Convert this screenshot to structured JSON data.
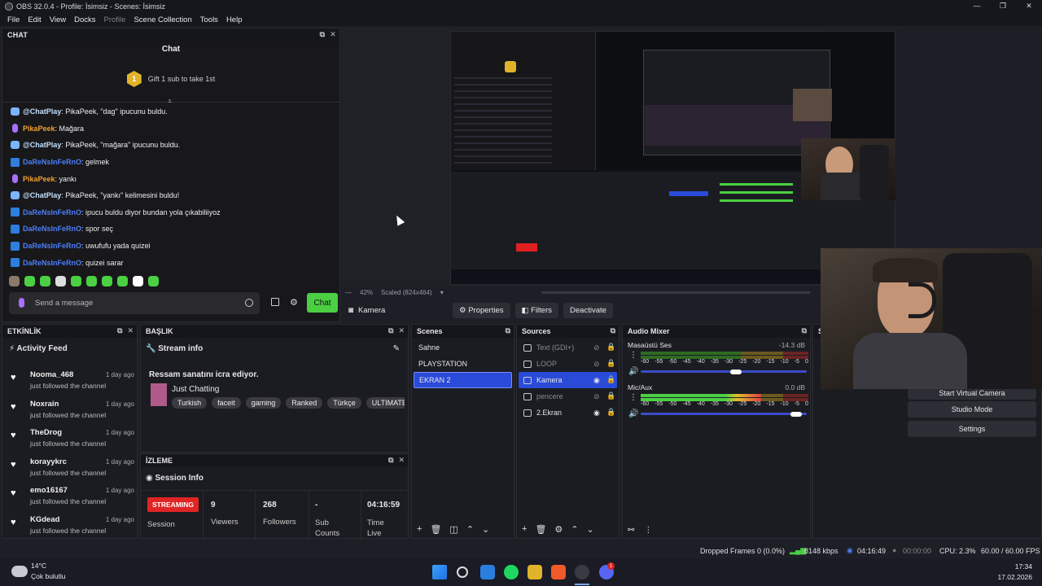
{
  "window": {
    "title": "OBS 32.0.4 - Profile: İsimsiz - Scenes: İsimsiz"
  },
  "menu": [
    "File",
    "Edit",
    "View",
    "Docks",
    "Profile",
    "Scene Collection",
    "Tools",
    "Help"
  ],
  "chat": {
    "dock_title": "CHAT",
    "header": "Chat",
    "gift_badge": "1",
    "gift_text": "Gift 1 sub to take 1st",
    "messages": [
      {
        "icon": "bot",
        "name": "@ChatPlay",
        "name_color": "#bfe0ff",
        "text": ": PikaPeek, \"dag\" ipucunu buldu."
      },
      {
        "icon": "mic",
        "name": "PikaPeek",
        "name_color": "#f0a030",
        "text": ": Mağara"
      },
      {
        "icon": "bot",
        "name": "@ChatPlay",
        "name_color": "#bfe0ff",
        "text": ": PikaPeek, \"mağara\" ipucunu buldu."
      },
      {
        "icon": "user",
        "name": "DaReNsInFeRnO",
        "name_color": "#4d7ef7",
        "text": ": gelmek"
      },
      {
        "icon": "mic",
        "name": "PikaPeek",
        "name_color": "#f0a030",
        "text": ": yankı"
      },
      {
        "icon": "bot",
        "name": "@ChatPlay",
        "name_color": "#bfe0ff",
        "text": ": PikaPeek, \"yankı\" kelimesini buldu!"
      },
      {
        "icon": "user",
        "name": "DaReNsInFeRnO",
        "name_color": "#4d7ef7",
        "text": ": ipucu buldu diyor bundan yola çıkabiliiyoz"
      },
      {
        "icon": "user",
        "name": "DaReNsInFeRnO",
        "name_color": "#4d7ef7",
        "text": ": spor seç"
      },
      {
        "icon": "user",
        "name": "DaReNsInFeRnO",
        "name_color": "#4d7ef7",
        "text": ": uwufufu yada quizei"
      },
      {
        "icon": "user",
        "name": "DaReNsInFeRnO",
        "name_color": "#4d7ef7",
        "text": ": quizei sarar"
      }
    ],
    "input_placeholder": "Send a message",
    "send_label": "Chat"
  },
  "preview": {
    "zoom": "42%",
    "scaled": "Scaled (824x464)"
  },
  "source_bar": {
    "selected_source": "Kamera",
    "properties": "Properties",
    "filters": "Filters",
    "deactivate": "Deactivate"
  },
  "activity": {
    "dock_title": "ETKİNLİK",
    "title": "Activity Feed",
    "items": [
      {
        "name": "Nooma_468",
        "time": "1 day ago",
        "sub": "just followed the channel"
      },
      {
        "name": "Noxrain",
        "time": "1 day ago",
        "sub": "just followed the channel"
      },
      {
        "name": "TheDrog",
        "time": "1 day ago",
        "sub": "just followed the channel"
      },
      {
        "name": "korayykrc",
        "time": "1 day ago",
        "sub": "just followed the channel"
      },
      {
        "name": "emo16167",
        "time": "1 day ago",
        "sub": "just followed the channel"
      },
      {
        "name": "KGdead",
        "time": "1 day ago",
        "sub": "just followed the channel"
      }
    ]
  },
  "stream_info": {
    "dock_title": "BAŞLIK",
    "title": "Stream info",
    "stream_title": "Ressam sanatını icra ediyor.",
    "category": "Just Chatting",
    "tags": [
      "Turkish",
      "faceit",
      "gaming",
      "Ranked",
      "Türkçe",
      "ULTIMATE"
    ]
  },
  "session": {
    "dock_title": "İZLEME",
    "title": "Session Info",
    "status": "STREAMING",
    "status_label": "Session",
    "viewers": "9",
    "viewers_label": "Viewers",
    "followers": "268",
    "followers_label": "Followers",
    "subs": "-",
    "subs_label": "Sub Counts",
    "time": "04:16:59",
    "time_label": "Time Live"
  },
  "scenes": {
    "title": "Scenes",
    "items": [
      "Sahne",
      "PLAYSTATION",
      "EKRAN 2"
    ],
    "selected": 2
  },
  "sources": {
    "title": "Sources",
    "items": [
      {
        "name": "Text (GDI+)",
        "visible": false
      },
      {
        "name": "LOOP",
        "visible": false
      },
      {
        "name": "Kamera",
        "visible": true
      },
      {
        "name": "pencere",
        "visible": false
      },
      {
        "name": "2.Ekran",
        "visible": true
      }
    ],
    "selected": 2
  },
  "mixer": {
    "title": "Audio Mixer",
    "ticks": [
      "-60",
      "-55",
      "-50",
      "-45",
      "-40",
      "-35",
      "-30",
      "-25",
      "-20",
      "-15",
      "-10",
      "-5",
      "0"
    ],
    "channels": [
      {
        "name": "Masaüstü Ses",
        "db": "-14.3 dB",
        "level": 0.0,
        "volume": 0.58
      },
      {
        "name": "Mic/Aux",
        "db": "0.0 dB",
        "level": 0.72,
        "volume": 0.97
      }
    ]
  },
  "controls": {
    "virtual_cam": "Start Virtual Camera",
    "studio_mode": "Studio Mode",
    "settings": "Settings"
  },
  "statusbar": {
    "dropped": "Dropped Frames 0 (0.0%)",
    "kbps": "8148 kbps",
    "live_time": "04:16:49",
    "rec_time": "00:00:00",
    "cpu": "CPU: 2.3%",
    "fps": "60.00 / 60.00 FPS"
  },
  "taskbar": {
    "weather_temp": "14°C",
    "weather_desc": "Çok bulutlu",
    "time": "17:34",
    "date": "17.02.2026",
    "notification_count": "1"
  }
}
